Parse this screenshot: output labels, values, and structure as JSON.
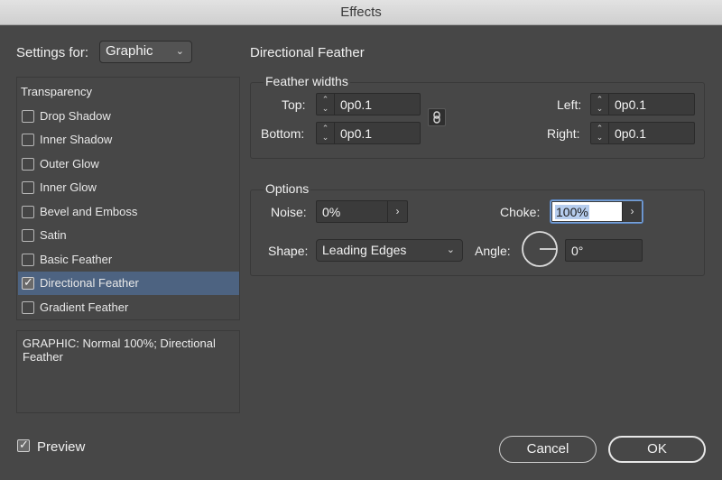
{
  "window": {
    "title": "Effects"
  },
  "settings": {
    "label": "Settings for:",
    "selected": "Graphic"
  },
  "effects_list": {
    "heading": "Transparency",
    "items": [
      {
        "label": "Drop Shadow",
        "checked": false
      },
      {
        "label": "Inner Shadow",
        "checked": false
      },
      {
        "label": "Outer Glow",
        "checked": false
      },
      {
        "label": "Inner Glow",
        "checked": false
      },
      {
        "label": "Bevel and Emboss",
        "checked": false
      },
      {
        "label": "Satin",
        "checked": false
      },
      {
        "label": "Basic Feather",
        "checked": false
      },
      {
        "label": "Directional Feather",
        "checked": true
      },
      {
        "label": "Gradient Feather",
        "checked": false
      }
    ]
  },
  "summary": {
    "text": "GRAPHIC: Normal 100%; Directional Feather"
  },
  "panel": {
    "title": "Directional Feather"
  },
  "feather_widths": {
    "title": "Feather widths",
    "top_label": "Top:",
    "top_value": "0p0.1",
    "bottom_label": "Bottom:",
    "bottom_value": "0p0.1",
    "left_label": "Left:",
    "left_value": "0p0.1",
    "right_label": "Right:",
    "right_value": "0p0.1"
  },
  "options": {
    "title": "Options",
    "noise_label": "Noise:",
    "noise_value": "0%",
    "choke_label": "Choke:",
    "choke_value": "100%",
    "shape_label": "Shape:",
    "shape_value": "Leading Edges",
    "angle_label": "Angle:",
    "angle_value": "0°"
  },
  "preview": {
    "label": "Preview",
    "checked": true
  },
  "buttons": {
    "cancel": "Cancel",
    "ok": "OK"
  },
  "icons": {
    "link": "link-icon",
    "chevron": "chevron-down-icon",
    "arrow": "chevron-right-icon",
    "check": "checkmark-icon"
  }
}
